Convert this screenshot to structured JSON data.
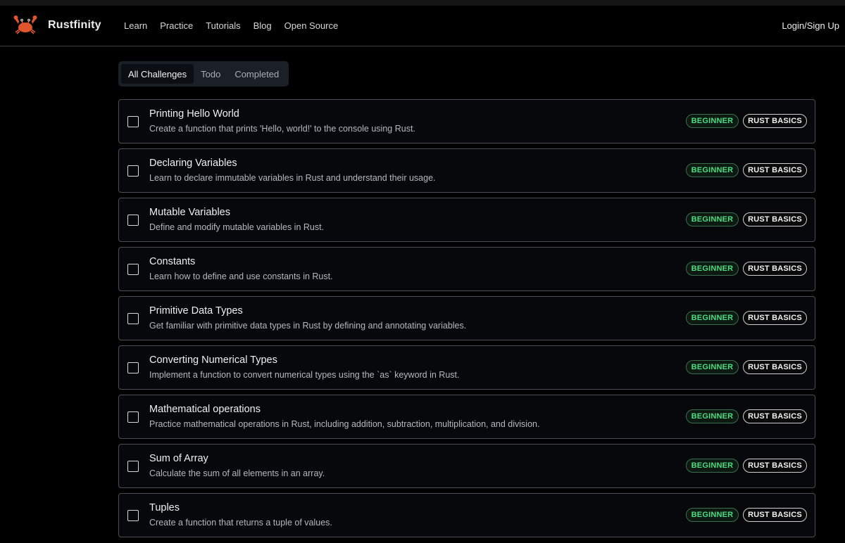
{
  "header": {
    "brand": "Rustfinity",
    "nav": [
      "Learn",
      "Practice",
      "Tutorials",
      "Blog",
      "Open Source"
    ],
    "login": "Login/Sign Up",
    "logo_icon": "crab-icon"
  },
  "tabs": [
    {
      "label": "All Challenges",
      "active": true
    },
    {
      "label": "Todo",
      "active": false
    },
    {
      "label": "Completed",
      "active": false
    }
  ],
  "colors": {
    "level_badge": "#4ade80",
    "background": "#000000",
    "card_border": "#4a4f57"
  },
  "challenges": [
    {
      "title": "Printing Hello World",
      "description": "Create a function that prints 'Hello, world!' to the console using Rust.",
      "level": "BEGINNER",
      "topic": "RUST BASICS",
      "completed": false
    },
    {
      "title": "Declaring Variables",
      "description": "Learn to declare immutable variables in Rust and understand their usage.",
      "level": "BEGINNER",
      "topic": "RUST BASICS",
      "completed": false
    },
    {
      "title": "Mutable Variables",
      "description": "Define and modify mutable variables in Rust.",
      "level": "BEGINNER",
      "topic": "RUST BASICS",
      "completed": false
    },
    {
      "title": "Constants",
      "description": "Learn how to define and use constants in Rust.",
      "level": "BEGINNER",
      "topic": "RUST BASICS",
      "completed": false
    },
    {
      "title": "Primitive Data Types",
      "description": "Get familiar with primitive data types in Rust by defining and annotating variables.",
      "level": "BEGINNER",
      "topic": "RUST BASICS",
      "completed": false
    },
    {
      "title": "Converting Numerical Types",
      "description": "Implement a function to convert numerical types using the `as` keyword in Rust.",
      "level": "BEGINNER",
      "topic": "RUST BASICS",
      "completed": false
    },
    {
      "title": "Mathematical operations",
      "description": "Practice mathematical operations in Rust, including addition, subtraction, multiplication, and division.",
      "level": "BEGINNER",
      "topic": "RUST BASICS",
      "completed": false
    },
    {
      "title": "Sum of Array",
      "description": "Calculate the sum of all elements in an array.",
      "level": "BEGINNER",
      "topic": "RUST BASICS",
      "completed": false
    },
    {
      "title": "Tuples",
      "description": "Create a function that returns a tuple of values.",
      "level": "BEGINNER",
      "topic": "RUST BASICS",
      "completed": false
    }
  ]
}
